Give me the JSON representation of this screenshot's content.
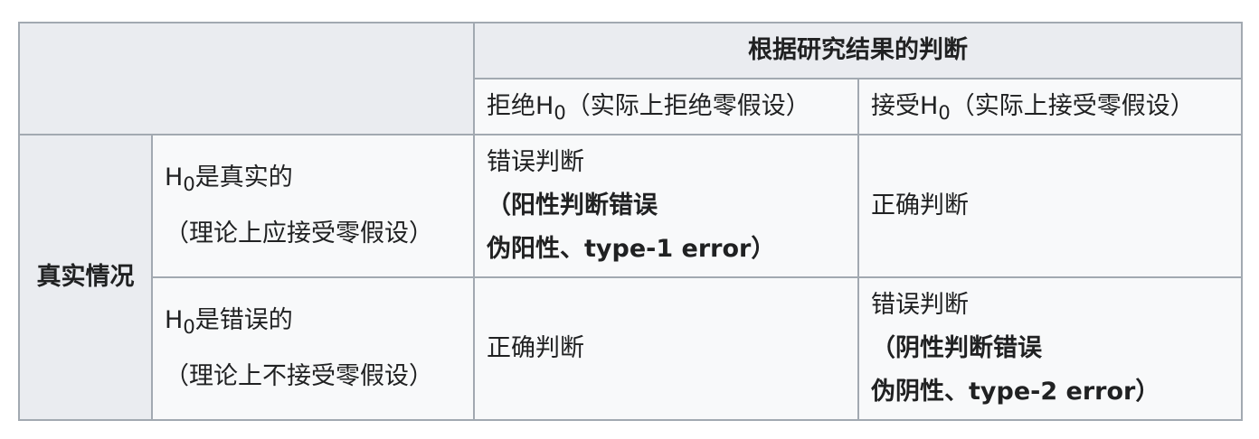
{
  "table": {
    "header_group": "根据研究结果的判断",
    "col_reject": {
      "pre": "拒绝H",
      "sub": "0",
      "post": "（实际上拒绝零假设）"
    },
    "col_accept": {
      "pre": "接受H",
      "sub": "0",
      "post": "（实际上接受零假设）"
    },
    "row_group": "真实情况",
    "row_true": {
      "pre": "H",
      "sub": "0",
      "post": "是真实的",
      "line2": "（理论上应接受零假设）",
      "reject_cell": {
        "line1": "错误判断",
        "line2": "（阳性判断错误",
        "line3": "伪阳性、type-1 error）"
      },
      "accept_cell": "正确判断"
    },
    "row_false": {
      "pre": "H",
      "sub": "0",
      "post": "是错误的",
      "line2": "（理论上不接受零假设）",
      "reject_cell": "正确判断",
      "accept_cell": {
        "line1": "错误判断",
        "line2": "（阴性判断错误",
        "line3": "伪阴性、type-2 error）"
      }
    }
  }
}
